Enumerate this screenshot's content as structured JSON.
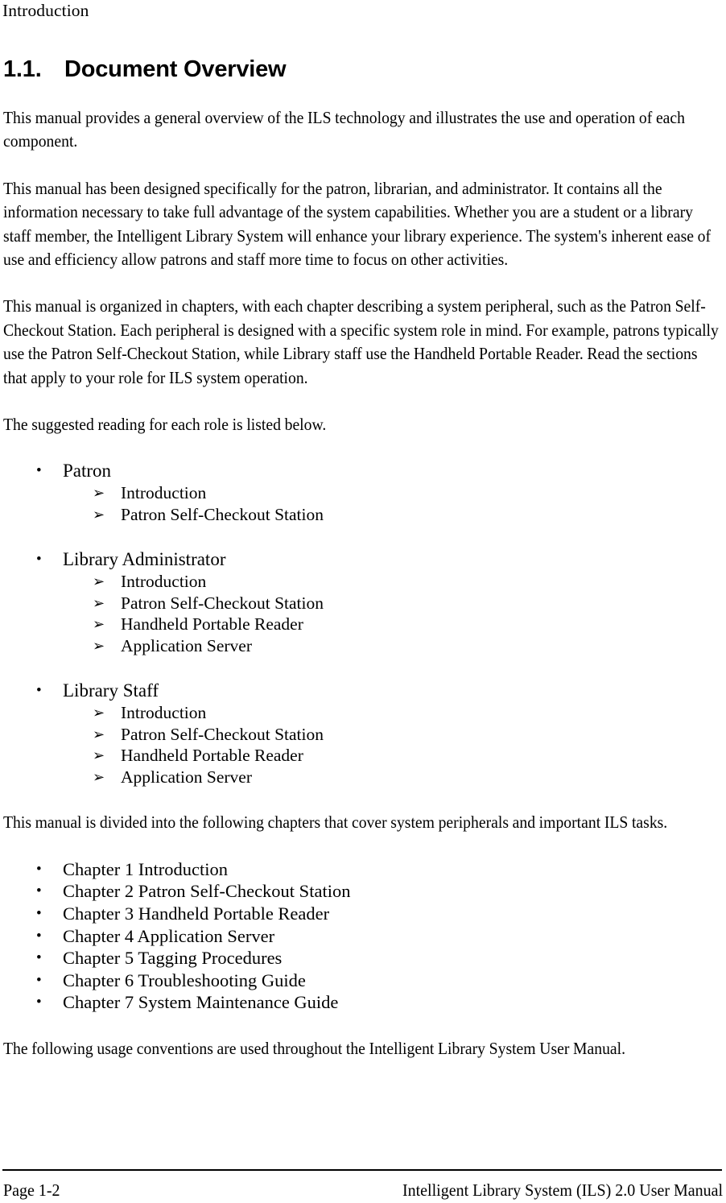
{
  "page": {
    "running_header": "Introduction"
  },
  "heading": {
    "number": "1.1.",
    "title": "Document Overview"
  },
  "paragraphs": {
    "p1": "This manual provides a general overview of the ILS technology and illustrates the use and operation of each component.",
    "p2": "This manual has been designed specifically for the patron, librarian, and administrator. It contains all the information necessary to take full advantage of the system capabilities. Whether you are a student or a library staff member, the Intelligent Library System will enhance your library experience. The system's inherent ease of use and efficiency allow patrons and staff more time to focus on other activities.",
    "p3": "This manual is organized in chapters, with each chapter describing a system peripheral, such as the Patron Self-Checkout Station. Each peripheral is designed with a specific system role in mind. For example, patrons typically use the Patron Self-Checkout Station, while Library staff use the Handheld Portable Reader. Read the sections that apply to your role for ILS system operation.",
    "p4": "The suggested reading for each role is listed below.",
    "p5": "This manual is divided into the following chapters that cover system peripherals and important ILS tasks.",
    "p6": "The following usage conventions are used throughout the Intelligent Library System User Manual."
  },
  "bullet_glyphs": {
    "level1": "•",
    "level2": "➢"
  },
  "reading_roles": [
    {
      "role": "Patron",
      "items": [
        "Introduction",
        "Patron Self-Checkout Station"
      ]
    },
    {
      "role": "Library Administrator",
      "items": [
        "Introduction",
        "Patron Self-Checkout Station",
        "Handheld Portable Reader",
        "Application Server"
      ]
    },
    {
      "role": "Library Staff",
      "items": [
        "Introduction",
        "Patron Self-Checkout Station",
        "Handheld Portable Reader",
        "Application Server"
      ]
    }
  ],
  "chapters": [
    "Chapter 1 Introduction",
    "Chapter 2 Patron Self-Checkout Station",
    "Chapter 3 Handheld Portable Reader",
    "Chapter 4 Application Server",
    "Chapter 5 Tagging Procedures",
    "Chapter 6 Troubleshooting Guide",
    "Chapter 7 System Maintenance Guide"
  ],
  "footer": {
    "left": "Page 1-2",
    "right": "Intelligent Library System (ILS) 2.0 User Manual"
  }
}
